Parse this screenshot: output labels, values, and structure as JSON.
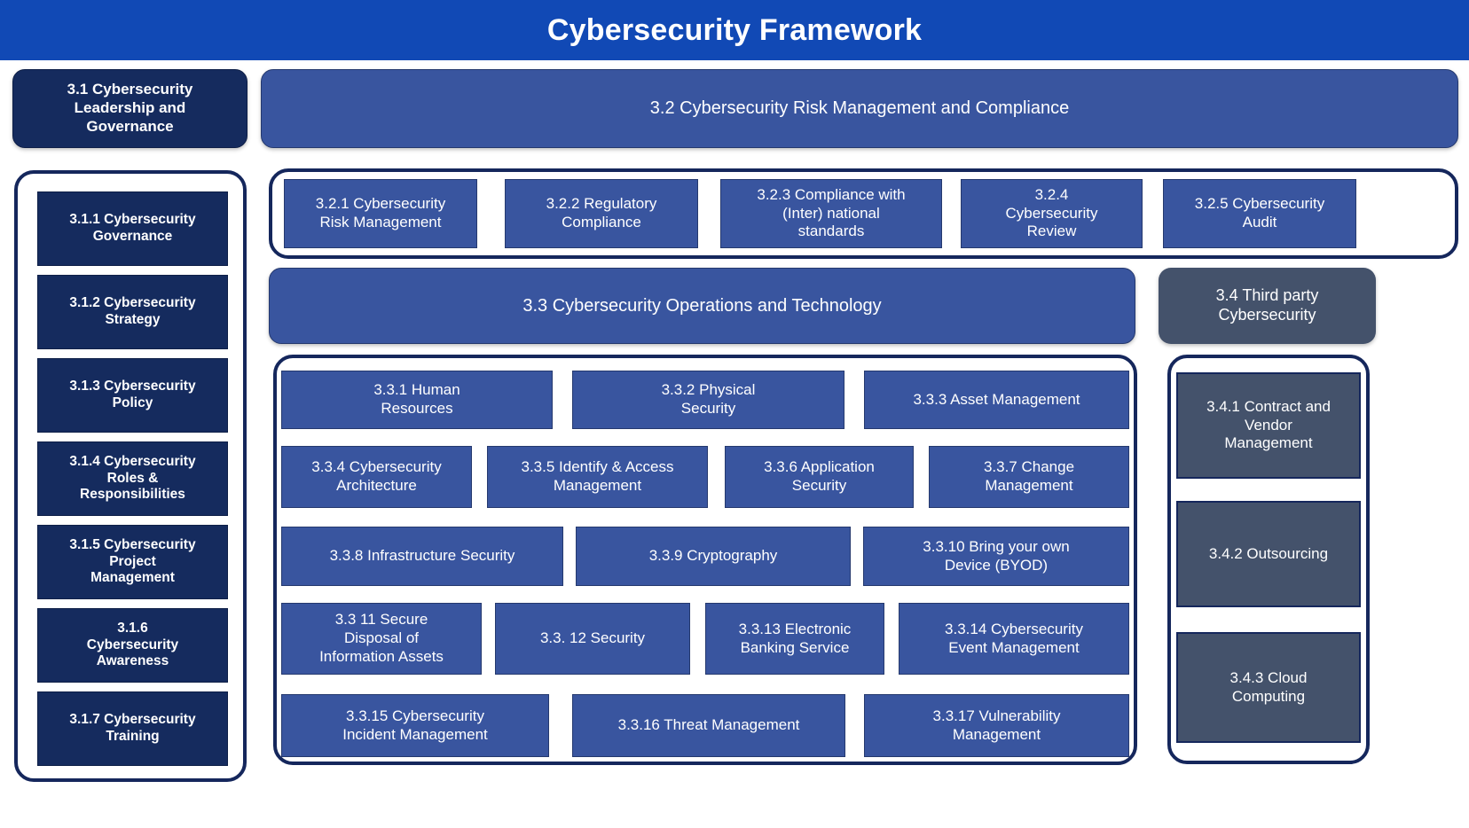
{
  "header": {
    "title": "Cybersecurity Framework",
    "bg_color": "#1149b5",
    "text_color": "#ffffff"
  },
  "colors": {
    "navy": "#152b5e",
    "mid_blue": "#39559f",
    "slate": "#44526b",
    "outline": "#15275c",
    "header_blue": "#1149b5"
  },
  "pillars": {
    "leadership": {
      "label": "3.1 Cybersecurity\nLeadership and\nGovernance",
      "children": [
        {
          "label": "3.1.1 Cybersecurity\nGovernance"
        },
        {
          "label": "3.1.2 Cybersecurity\nStrategy"
        },
        {
          "label": "3.1.3 Cybersecurity\nPolicy"
        },
        {
          "label": "3.1.4 Cybersecurity\nRoles &\nResponsibilities"
        },
        {
          "label": "3.1.5 Cybersecurity\nProject\nManagement"
        },
        {
          "label": "3.1.6\nCybersecurity\nAwareness"
        },
        {
          "label": "3.1.7 Cybersecurity\nTraining"
        }
      ]
    },
    "risk": {
      "label": "3.2 Cybersecurity Risk Management and Compliance",
      "children": [
        {
          "label": "3.2.1 Cybersecurity\nRisk Management"
        },
        {
          "label": "3.2.2 Regulatory\nCompliance"
        },
        {
          "label": "3.2.3 Compliance with\n(Inter) national\nstandards"
        },
        {
          "label": "3.2.4\nCybersecurity\nReview"
        },
        {
          "label": "3.2.5 Cybersecurity\nAudit"
        }
      ]
    },
    "operations": {
      "label": "3.3 Cybersecurity Operations and Technology",
      "children": [
        {
          "label": "3.3.1 Human\nResources"
        },
        {
          "label": "3.3.2 Physical\nSecurity"
        },
        {
          "label": "3.3.3 Asset Management"
        },
        {
          "label": "3.3.4 Cybersecurity\nArchitecture"
        },
        {
          "label": "3.3.5 Identify & Access\nManagement"
        },
        {
          "label": "3.3.6 Application\nSecurity"
        },
        {
          "label": "3.3.7 Change\nManagement"
        },
        {
          "label": "3.3.8 Infrastructure Security"
        },
        {
          "label": "3.3.9 Cryptography"
        },
        {
          "label": "3.3.10 Bring your own\nDevice (BYOD)"
        },
        {
          "label": "3.3 11 Secure\nDisposal of\nInformation Assets"
        },
        {
          "label": "3.3. 12 Security"
        },
        {
          "label": "3.3.13 Electronic\nBanking Service"
        },
        {
          "label": "3.3.14 Cybersecurity\nEvent Management"
        },
        {
          "label": "3.3.15 Cybersecurity\nIncident Management"
        },
        {
          "label": "3.3.16 Threat Management"
        },
        {
          "label": "3.3.17 Vulnerability\nManagement"
        }
      ]
    },
    "third_party": {
      "label": "3.4 Third party\nCybersecurity",
      "children": [
        {
          "label": "3.4.1 Contract and\nVendor\nManagement"
        },
        {
          "label": "3.4.2 Outsourcing"
        },
        {
          "label": "3.4.3 Cloud\nComputing"
        }
      ]
    }
  }
}
